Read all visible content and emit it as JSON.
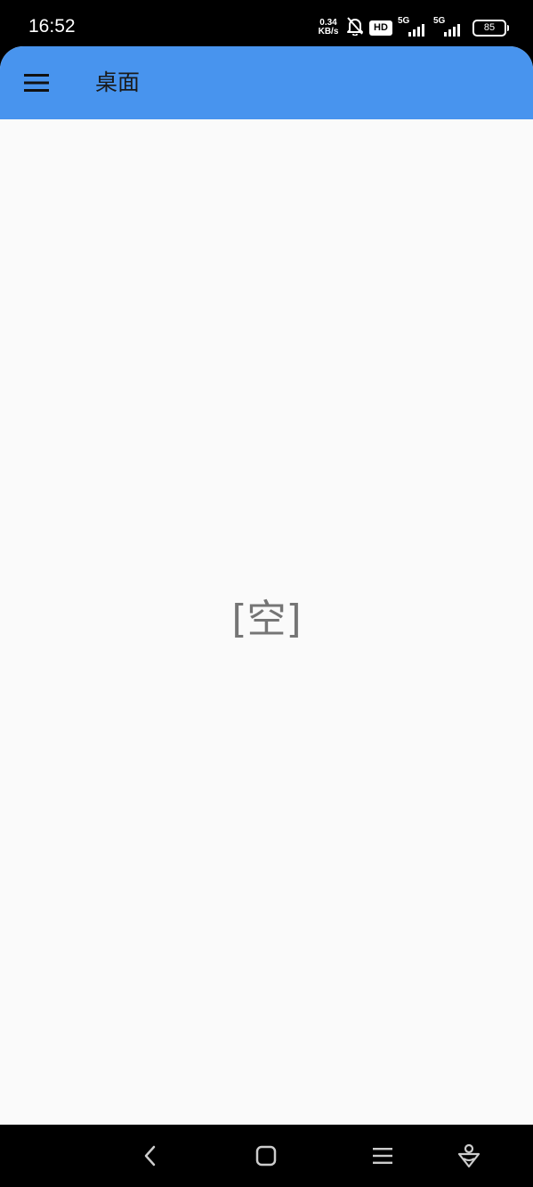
{
  "status_bar": {
    "time": "16:52",
    "net_speed_value": "0.34",
    "net_speed_unit": "KB/s",
    "hd_label": "HD",
    "signal1_label": "5G",
    "signal2_label": "5G",
    "battery_level": "85"
  },
  "app_bar": {
    "title": "桌面",
    "color": "#4894ee"
  },
  "main": {
    "empty_text": "[空]"
  },
  "icons": {
    "menu": "hamburger-menu-icon",
    "back": "back-chevron-icon",
    "home": "home-square-icon",
    "recents": "recents-menu-icon",
    "assistant": "assistant-icon"
  }
}
